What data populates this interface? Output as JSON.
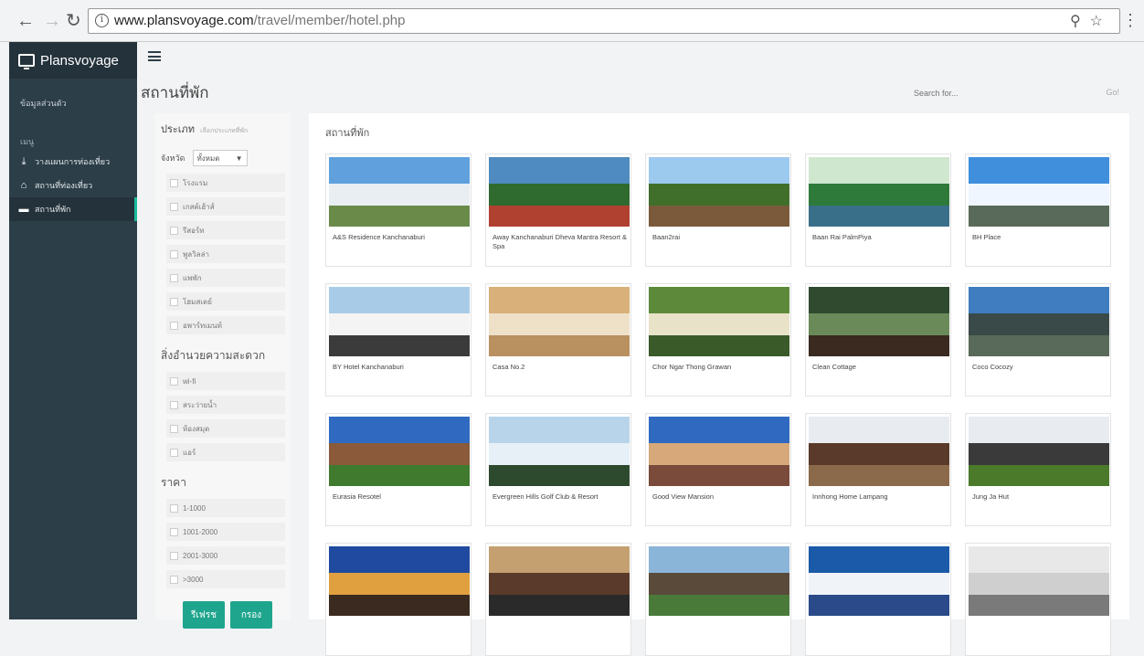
{
  "browser": {
    "url_host": "www.plansvoyage.com",
    "url_path": "/travel/member/hotel.php"
  },
  "sidebar": {
    "brand": "Plansvoyage",
    "edit_link": "ข้อมูลส่วนตัว",
    "section_label": "เมนู",
    "items": [
      {
        "label": "วางแผนการท่องเที่ยว"
      },
      {
        "label": "สถานที่ท่องเที่ยว"
      },
      {
        "label": "สถานที่พัก"
      }
    ]
  },
  "header": {
    "title": "สถานที่พัก",
    "search_placeholder": "Search for...",
    "go_label": "Go!"
  },
  "filter": {
    "type_heading": "ประเภท",
    "type_hint": "เลือกประเภทที่พัก",
    "province_label": "จังหวัด",
    "province_value": "ทั้งหมด",
    "types": [
      "โรงแรม",
      "เกสต์เฮ้าส์",
      "รีสอร์ท",
      "พูลวิลล่า",
      "แพพัก",
      "โฮมสเตย์",
      "อพาร์ทเมนท์"
    ],
    "amenity_heading": "สิ่งอำนวยความสะดวก",
    "amenities": [
      "wi-fi",
      "สระว่ายน้ำ",
      "ห้องสมุด",
      "แอร์"
    ],
    "price_heading": "ราคา",
    "prices": [
      "1-1000",
      "1001-2000",
      "2001-3000",
      ">3000"
    ],
    "reset_label": "รีเฟรช",
    "filter_label": "กรอง"
  },
  "results": {
    "title": "สถานที่พัก",
    "cards": [
      {
        "name": "A&S Residence Kanchanaburi"
      },
      {
        "name": "Away Kanchanaburi Dheva Mantra Resort & Spa"
      },
      {
        "name": "Baan2rai"
      },
      {
        "name": "Baan Rai PalmPiya"
      },
      {
        "name": "BH Place"
      },
      {
        "name": "BY Hotel Kanchanaburi"
      },
      {
        "name": "Casa No.2"
      },
      {
        "name": "Chor Ngar Thong Grawan"
      },
      {
        "name": "Clean Cottage"
      },
      {
        "name": "Coco Cocozy"
      },
      {
        "name": "Eurasia Resotel"
      },
      {
        "name": "Evergreen Hills Golf Club & Resort"
      },
      {
        "name": "Good View Mansion"
      },
      {
        "name": "Innhong Home Lampang"
      },
      {
        "name": "Jung Ja Hut"
      },
      {
        "name": ""
      },
      {
        "name": ""
      },
      {
        "name": ""
      },
      {
        "name": ""
      },
      {
        "name": ""
      }
    ]
  }
}
